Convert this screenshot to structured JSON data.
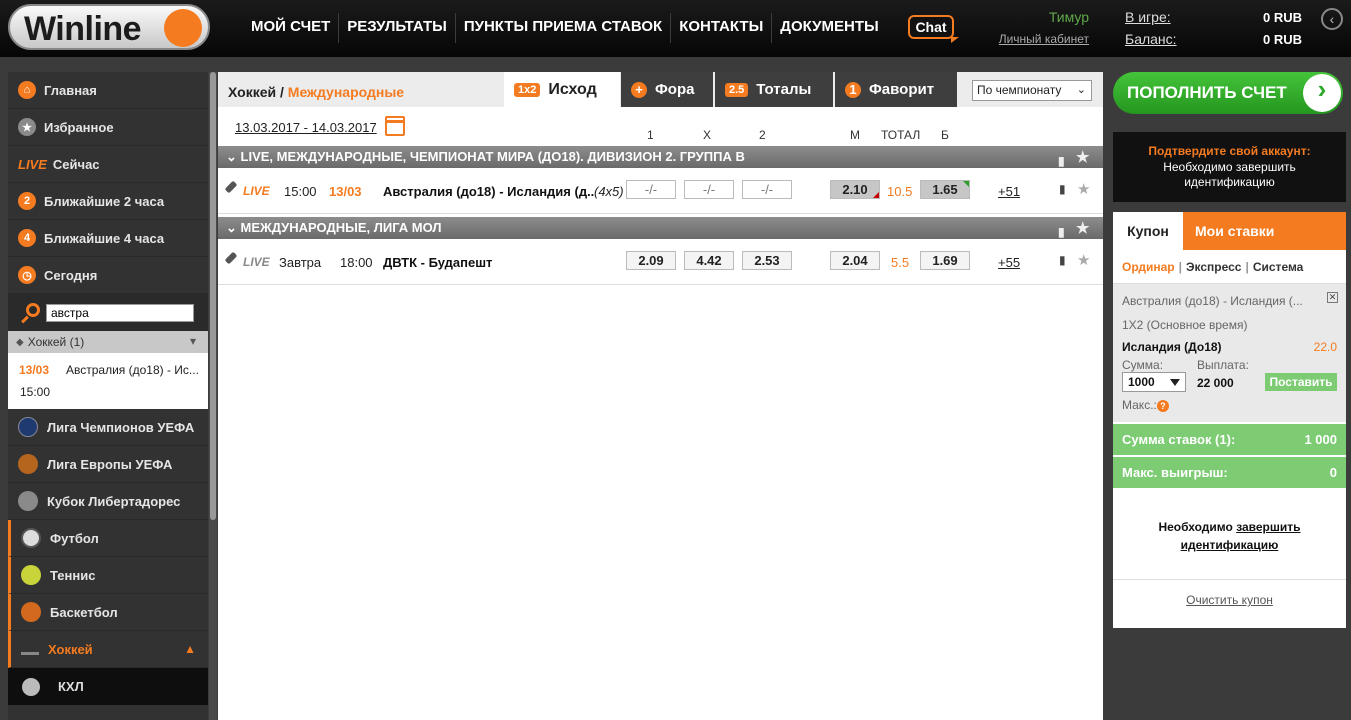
{
  "header": {
    "logo": "Winline",
    "nav": [
      "МОЙ СЧЕТ",
      "РЕЗУЛЬТАТЫ",
      "ПУНКТЫ ПРИЕМА СТАВОК",
      "КОНТАКТЫ",
      "ДОКУМЕНТЫ"
    ],
    "chat": "Chat",
    "user_name": "Тимур",
    "cabinet": "Личный кабинет",
    "in_game_label": "В игре:",
    "in_game_value": "0 RUB",
    "balance_label": "Баланс:",
    "balance_value": "0 RUB",
    "back": "‹"
  },
  "sidebar": {
    "items": [
      {
        "label": "Главная",
        "icon": "home-icon"
      },
      {
        "label": "Избранное",
        "icon": "star-icon"
      },
      {
        "label": "Сейчас",
        "live": "LIVE"
      },
      {
        "label": "Ближайшие 2 часа",
        "badge": "2"
      },
      {
        "label": "Ближайшие 4 часа",
        "badge": "4"
      },
      {
        "label": "Сегодня",
        "icon": "clock-icon"
      }
    ],
    "search": {
      "value": "австра"
    },
    "result_group": "Хоккей (1)",
    "result": {
      "date": "13/03",
      "name": "Австралия (до18) - Ис...",
      "time": "15:00"
    },
    "sports": [
      {
        "label": "Лига Чемпионов УЕФА",
        "color": "#1f3a6e"
      },
      {
        "label": "Лига Европы УЕФА",
        "color": "#b5651d"
      },
      {
        "label": "Кубок Либертадорес",
        "color": "#8a8a8a"
      },
      {
        "label": "Футбол",
        "color": "#dddddd"
      },
      {
        "label": "Теннис",
        "color": "#c9d33a"
      },
      {
        "label": "Баскетбол",
        "color": "#d2691e"
      }
    ],
    "hockey": "Хоккей",
    "khl": "КХЛ"
  },
  "main": {
    "breadcrumb_sport": "Хоккей",
    "breadcrumb_sep": "/",
    "breadcrumb_sub": "Международные",
    "tabs": [
      {
        "badge": "1x2",
        "label": "Исход"
      },
      {
        "badge": "+",
        "label": "Фора"
      },
      {
        "badge": "2.5",
        "label": "Тоталы"
      },
      {
        "badge": "1",
        "label": "Фаворит"
      }
    ],
    "champ_select": "По чемпионату",
    "date_range": "13.03.2017 - 14.03.2017",
    "columns": {
      "c1": "1",
      "cx": "X",
      "c2": "2",
      "m": "М",
      "total": "ТОТАЛ",
      "b": "Б"
    },
    "groups": [
      {
        "title": "LIVE,  МЕЖДУНАРОДНЫЕ, ЧЕМПИОНАТ МИРА (ДО18). ДИВИЗИОН 2. ГРУППА В",
        "row": {
          "live": "LIVE",
          "day": "",
          "time": "15:00",
          "date": "13/03",
          "name": "Австралия (до18) - Исландия (д..",
          "format": "(4x5)",
          "o1": "-/-",
          "ox": "-/-",
          "o2": "-/-",
          "m": "2.10",
          "total": "10.5",
          "b": "1.65",
          "more": "+51"
        }
      },
      {
        "title": "МЕЖДУНАРОДНЫЕ, ЛИГА МОЛ",
        "row": {
          "live": "LIVE",
          "day": "Завтра",
          "time": "18:00",
          "date": "",
          "name": "ДВТК - Будапешт",
          "format": "",
          "o1": "2.09",
          "ox": "4.42",
          "o2": "2.53",
          "m": "2.04",
          "total": "5.5",
          "b": "1.69",
          "more": "+55"
        }
      }
    ]
  },
  "right": {
    "topup": "ПОПОЛНИТЬ СЧЕТ",
    "verify_title": "Подтвердите свой аккаунт:",
    "verify_text": "Необходимо завершить идентификацию",
    "coupon_tab": "Купон",
    "mybets_tab": "Мои ставки",
    "bet_types": [
      "Ординар",
      "Экспресс",
      "Система"
    ],
    "slip": {
      "match": "Австралия (до18) - Исландия (...",
      "market": "1X2 (Основное время)",
      "outcome": "Исландия (До18)",
      "odd": "22.0",
      "sum_label": "Сумма:",
      "payout_label": "Выплата:",
      "amount": "1000",
      "payout": "22 000",
      "place": "Поставить",
      "max_label": "Макс.:",
      "q": "?"
    },
    "total_label": "Сумма ставок (1):",
    "total_value": "1 000",
    "max_win_label": "Макс. выигрыш:",
    "max_win_value": "0",
    "ident_prefix": "Необходимо",
    "ident_link": "завершить идентификацию",
    "clear": "Очистить купон"
  }
}
